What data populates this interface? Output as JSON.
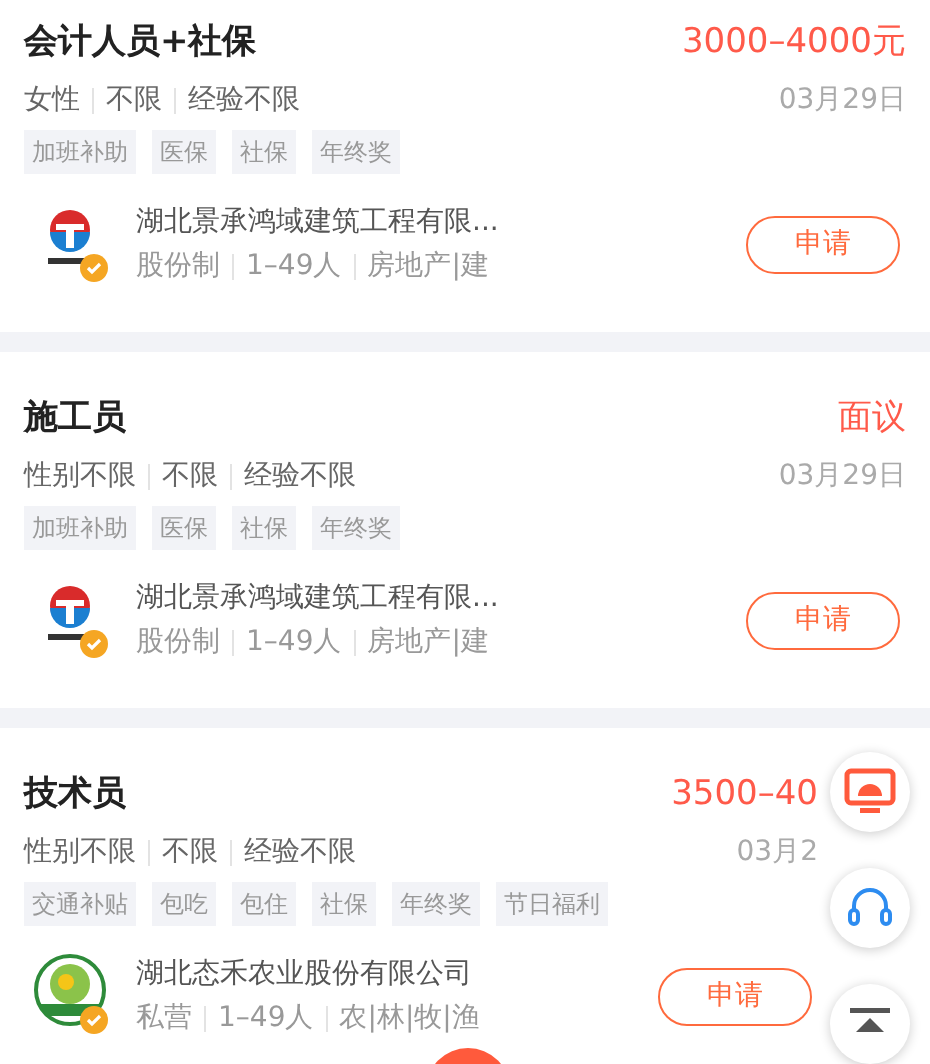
{
  "jobs": [
    {
      "title": "会计人员+社保",
      "salary": "3000–4000元",
      "requirements": [
        "女性",
        "不限",
        "经验不限"
      ],
      "date": "03月29日",
      "benefits": [
        "加班补助",
        "医保",
        "社保",
        "年终奖"
      ],
      "company": {
        "kind": "construction",
        "name": "湖北景承鸿域建筑工程有限...",
        "attributes": [
          "股份制",
          "1–49人",
          "房地产|建"
        ],
        "verified": true
      },
      "apply": "申请",
      "under_floating_buttons": false
    },
    {
      "title": "施工员",
      "salary": "面议",
      "requirements": [
        "性别不限",
        "不限",
        "经验不限"
      ],
      "date": "03月29日",
      "benefits": [
        "加班补助",
        "医保",
        "社保",
        "年终奖"
      ],
      "company": {
        "kind": "construction",
        "name": "湖北景承鸿域建筑工程有限...",
        "attributes": [
          "股份制",
          "1–49人",
          "房地产|建"
        ],
        "verified": true
      },
      "apply": "申请",
      "under_floating_buttons": false
    },
    {
      "title": "技术员",
      "salary": "3500–40",
      "requirements": [
        "性别不限",
        "不限",
        "经验不限"
      ],
      "date": "03月2",
      "benefits": [
        "交通补贴",
        "包吃",
        "包住",
        "社保",
        "年终奖",
        "节日福利"
      ],
      "company": {
        "kind": "agriculture",
        "name": "湖北态禾农业股份有限公司",
        "attributes": [
          "私营",
          "1–49人",
          "农|林|牧|渔"
        ],
        "verified": true
      },
      "apply": "申请",
      "under_floating_buttons": true
    }
  ],
  "floating_buttons": [
    {
      "kind": "monitor"
    },
    {
      "kind": "headset"
    },
    {
      "kind": "top"
    }
  ]
}
